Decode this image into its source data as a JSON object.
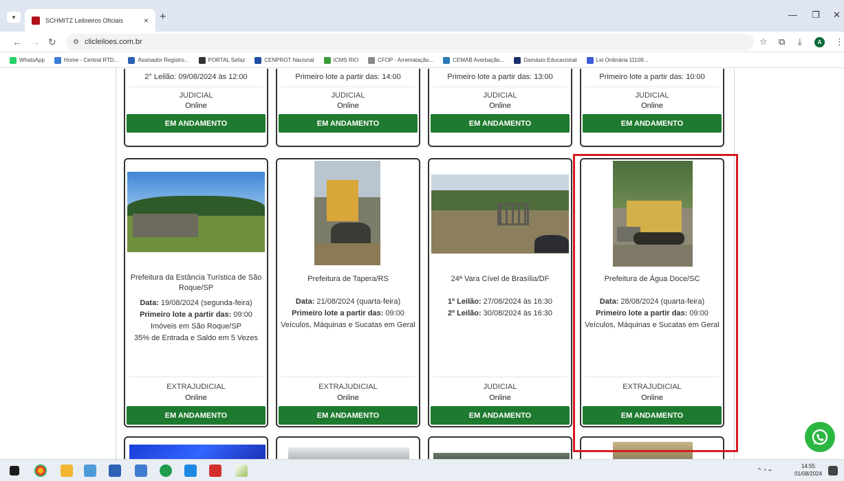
{
  "browser": {
    "tab_title": "SCHMITZ Leiloeiros Oficiais",
    "tab_close": "×",
    "new_tab": "+",
    "url": "clicleiloes.com.br",
    "bookmarks": [
      {
        "label": "WhatsApp",
        "color": "#25d366"
      },
      {
        "label": "Home - Central RTD...",
        "color": "#3a7bd5"
      },
      {
        "label": "Assinador Registro...",
        "color": "#2b5fb3"
      },
      {
        "label": "PORTAL Sefaz",
        "color": "#333333"
      },
      {
        "label": "CENPROT Nacional",
        "color": "#1f4ea3"
      },
      {
        "label": "ICMS RIO",
        "color": "#3a9b3a"
      },
      {
        "label": "CFOP - Arrematação...",
        "color": "#888888"
      },
      {
        "label": "CEMAB Averbação...",
        "color": "#2c7bb6"
      },
      {
        "label": "Damásio Educacional",
        "color": "#1a2f6b"
      },
      {
        "label": "Lei Ordinária 11109...",
        "color": "#3b5bdb"
      }
    ]
  },
  "top_cards": [
    {
      "partial_line": "2° Leilão: 09/08/2024 às 12:00",
      "type": "JUDICIAL",
      "mode": "Online",
      "status": "EM ANDAMENTO"
    },
    {
      "partial_line": "Primeiro lote a partir das: 14:00",
      "type": "JUDICIAL",
      "mode": "Online",
      "status": "EM ANDAMENTO"
    },
    {
      "partial_line": "Primeiro lote a partir das: 13:00",
      "type": "JUDICIAL",
      "mode": "Online",
      "status": "EM ANDAMENTO"
    },
    {
      "partial_line": "Primeiro lote a partir das: 10:00",
      "type": "JUDICIAL",
      "mode": "Online",
      "status": "EM ANDAMENTO"
    }
  ],
  "cards": [
    {
      "name": "Prefeitura da Estância Turística de São Roque/SP",
      "lines": [
        {
          "label": "Data:",
          "value": " 19/08/2024 (segunda-feira)"
        },
        {
          "label": "Primeiro lote a partir das:",
          "value": " 09:00"
        },
        {
          "label": "",
          "value": "Imóveis em São Roque/SP"
        },
        {
          "label": "",
          "value": "35% de Entrada e Saldo em 5 Vezes"
        }
      ],
      "type": "EXTRAJUDICIAL",
      "mode": "Online",
      "status": "EM ANDAMENTO"
    },
    {
      "name": "Prefeitura de Tapera/RS",
      "lines": [
        {
          "label": "Data:",
          "value": " 21/08/2024 (quarta-feira)"
        },
        {
          "label": "Primeiro lote a partir das:",
          "value": " 09:00"
        },
        {
          "label": "",
          "value": "Veículos, Máquinas e Sucatas em Geral"
        }
      ],
      "type": "EXTRAJUDICIAL",
      "mode": "Online",
      "status": "EM ANDAMENTO"
    },
    {
      "name": "24ª Vara Cível de Brasília/DF",
      "lines": [
        {
          "label": "1º Leilão:",
          "value": " 27/08/2024 às 16:30"
        },
        {
          "label": "2º Leilão:",
          "value": " 30/08/2024 às 16:30"
        }
      ],
      "type": "JUDICIAL",
      "mode": "Online",
      "status": "EM ANDAMENTO"
    },
    {
      "name": "Prefeitura de Água Doce/SC",
      "lines": [
        {
          "label": "Data:",
          "value": " 28/08/2024 (quarta-feira)"
        },
        {
          "label": "Primeiro lote a partir das:",
          "value": " 09:00"
        },
        {
          "label": "",
          "value": "Veículos, Máquinas e Sucatas em Geral"
        }
      ],
      "type": "EXTRAJUDICIAL",
      "mode": "Online",
      "status": "EM ANDAMENTO"
    }
  ],
  "taskbar": {
    "time": "14:55",
    "date": "01/08/2024"
  }
}
